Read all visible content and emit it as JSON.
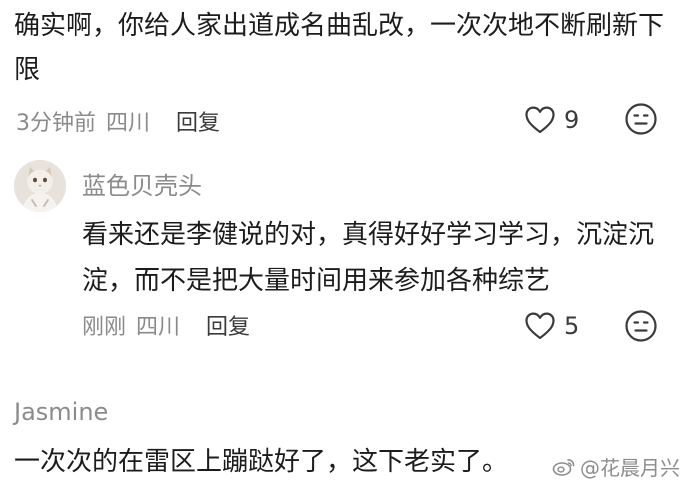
{
  "root_comment": {
    "text": "确实啊，你给人家出道成名曲乱改，一次次地不断刷新下限",
    "time": "3分钟前",
    "location": "四川",
    "reply_label": "回复",
    "likes": "9"
  },
  "reply": {
    "author": "蓝色贝壳头",
    "text": "看来还是李健说的对，真得好好学习学习，沉淀沉淀，而不是把大量时间用来参加各种综艺",
    "time": "刚刚",
    "location": "四川",
    "reply_label": "回复",
    "likes": "5"
  },
  "third_comment": {
    "author": "Jasmine",
    "text": "一次次的在雷区上蹦跶好了，这下老实了。"
  },
  "watermark": {
    "text": "@花晨月兴"
  },
  "icons": {
    "like": "heart-outline-icon",
    "reaction": "neutral-face-icon",
    "avatar": "cat-avatar",
    "watermark": "weibo-logo-icon"
  },
  "colors": {
    "text_primary": "#1c1c1c",
    "text_secondary": "#8b8b8b",
    "icon": "#3b3b3b",
    "background": "#ffffff"
  }
}
